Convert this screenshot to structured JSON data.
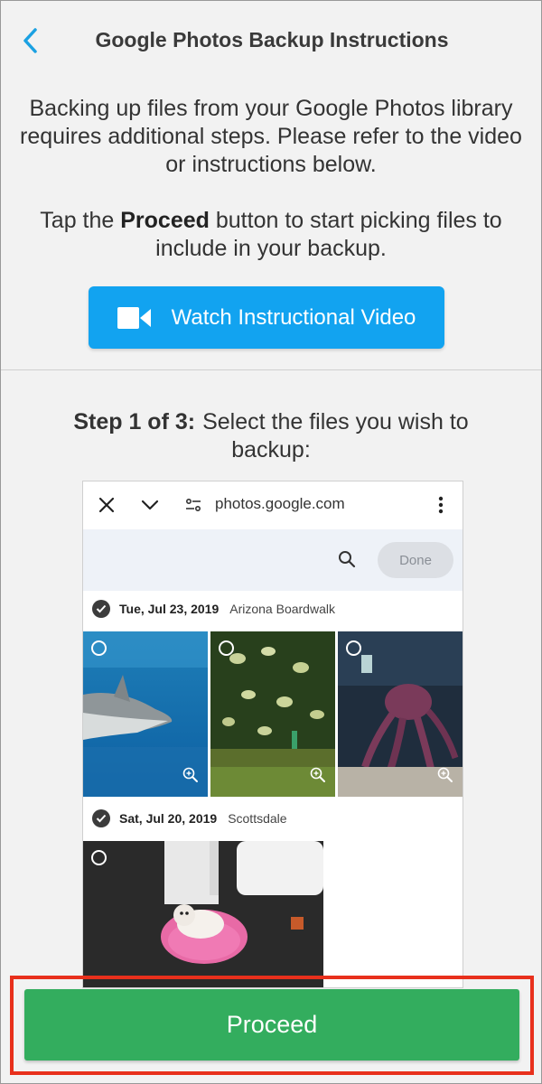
{
  "header": {
    "title": "Google Photos Backup Instructions",
    "back_icon": "chevron-left-icon",
    "accent": "#1ba1e2"
  },
  "intro": {
    "paragraph": "Backing up files from your Google Photos library requires additional steps. Please refer to the video or instructions below.",
    "tap_prefix": "Tap the ",
    "tap_bold": "Proceed",
    "tap_suffix": " button to start picking files to include in your backup."
  },
  "watch_button": {
    "label": "Watch Instructional Video",
    "icon": "video-camera-icon",
    "color": "#12a3f0"
  },
  "step": {
    "label": "Step 1 of 3:",
    "text": "Select the files you wish to backup:"
  },
  "screenshot": {
    "url": "photos.google.com",
    "done_label": "Done",
    "groups": [
      {
        "date": "Tue, Jul 23, 2019",
        "place": "Arizona Boardwalk",
        "photos": [
          "shark",
          "jellyfish",
          "octopus"
        ]
      },
      {
        "date": "Sat, Jul 20, 2019",
        "place": "Scottsdale",
        "photos": [
          "dog"
        ]
      }
    ]
  },
  "proceed_button": {
    "label": "Proceed",
    "color": "#33ad5e",
    "highlight_color": "#e8301c"
  }
}
